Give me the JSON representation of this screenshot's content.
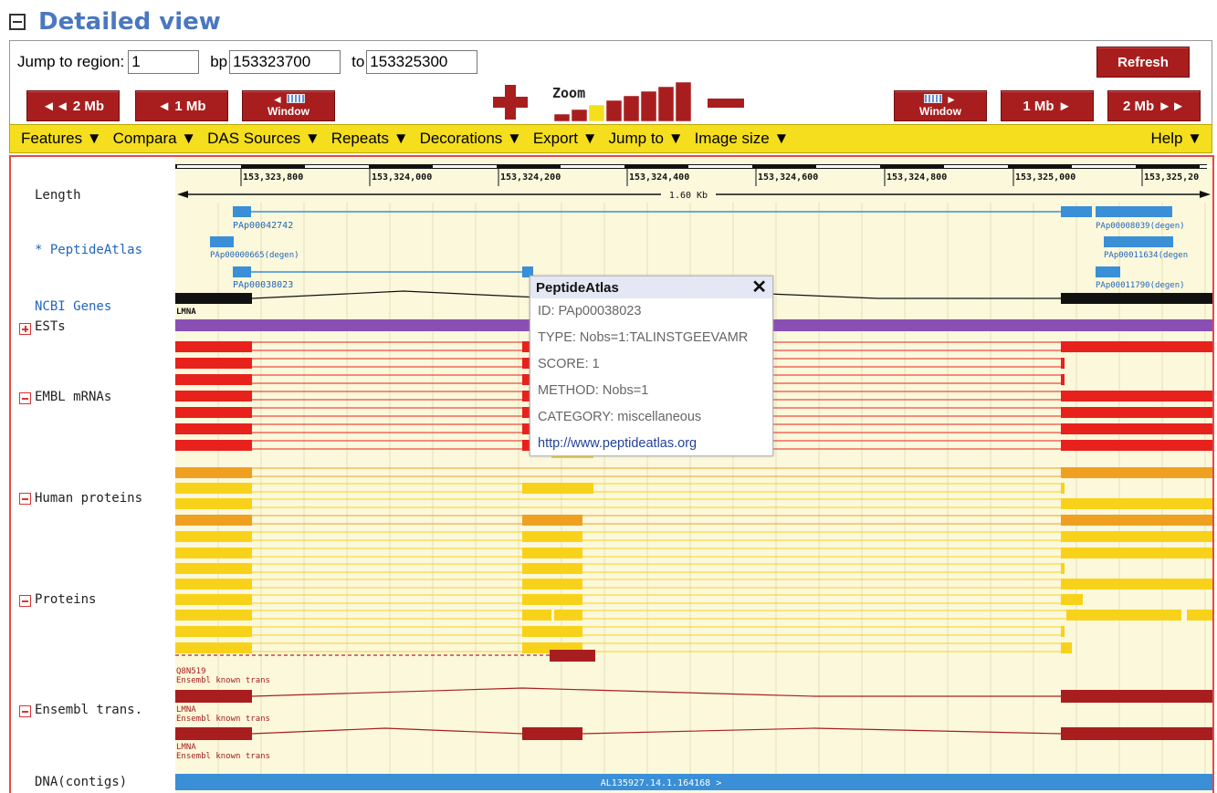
{
  "header": {
    "title": "Detailed view"
  },
  "jump": {
    "label": "Jump to region:",
    "chromosome": "1",
    "bp_label": "bp",
    "start": "153323700",
    "to_label": "to",
    "end": "153325300",
    "refresh_label": "Refresh"
  },
  "nav": {
    "left_2mb": "◄◄ 2 Mb",
    "left_1mb": "◄  1 Mb",
    "left_window": "Window",
    "right_window": "Window",
    "right_1mb": "1 Mb  ►",
    "right_2mb": "2 Mb ►►",
    "zoom_label": "Zoom",
    "zoom_levels": 8,
    "zoom_selected": 2
  },
  "menu": {
    "items": [
      "Features ▼",
      "Compara ▼",
      "DAS Sources ▼",
      "Repeats ▼",
      "Decorations ▼",
      "Export ▼",
      "Jump to ▼",
      "Image size ▼"
    ],
    "help": "Help ▼"
  },
  "ruler": {
    "ticks": [
      "153,323,800",
      "153,324,000",
      "153,324,200",
      "153,324,400",
      "153,324,600",
      "153,324,800",
      "153,325,000",
      "153,325,20"
    ],
    "length_text": "1.60 Kb"
  },
  "tracks": {
    "length": "Length",
    "peptideatlas": "* PeptideAtlas",
    "ncbi": "NCBI Genes",
    "ests": "ESTs",
    "embl": "EMBL mRNAs",
    "human_proteins": "Human proteins",
    "proteins": "Proteins",
    "ensembl": "Ensembl trans.",
    "dna": "DNA(contigs)"
  },
  "feature_labels": {
    "pa1": "PAp00042742",
    "pa2": "PAp00000665(degen)",
    "pa3": "PAp00038023",
    "pa4": "PAp00008039(degen)",
    "pa5": "PAp00011634(degen",
    "pa6": "PAp00011790(degen)",
    "lmna": "LMNA",
    "q8n": "Q8N519",
    "ens_known": "Ensembl known trans",
    "contig": "AL135927.14.1.164168 >"
  },
  "popup": {
    "title": "PeptideAtlas",
    "close": "✕",
    "id": "ID: PAp00038023",
    "type": "TYPE: Nobs=1:TALINSTGEEVAMR",
    "score": "SCORE: 1",
    "method": "METHOD: Nobs=1",
    "category": "CATEGORY: miscellaneous",
    "link": "http://www.peptideatlas.org"
  },
  "colors": {
    "accent_red": "#a81e1e",
    "menu_yellow": "#f4de1e",
    "track_blue": "#3a8fd6",
    "est_purple": "#8a4fb4",
    "mrna_red": "#e8211c",
    "protein_orange": "#f0a020",
    "protein_yellow": "#f8d21a",
    "ensembl_darkred": "#a81e1e",
    "title_blue": "#4a77c0"
  }
}
